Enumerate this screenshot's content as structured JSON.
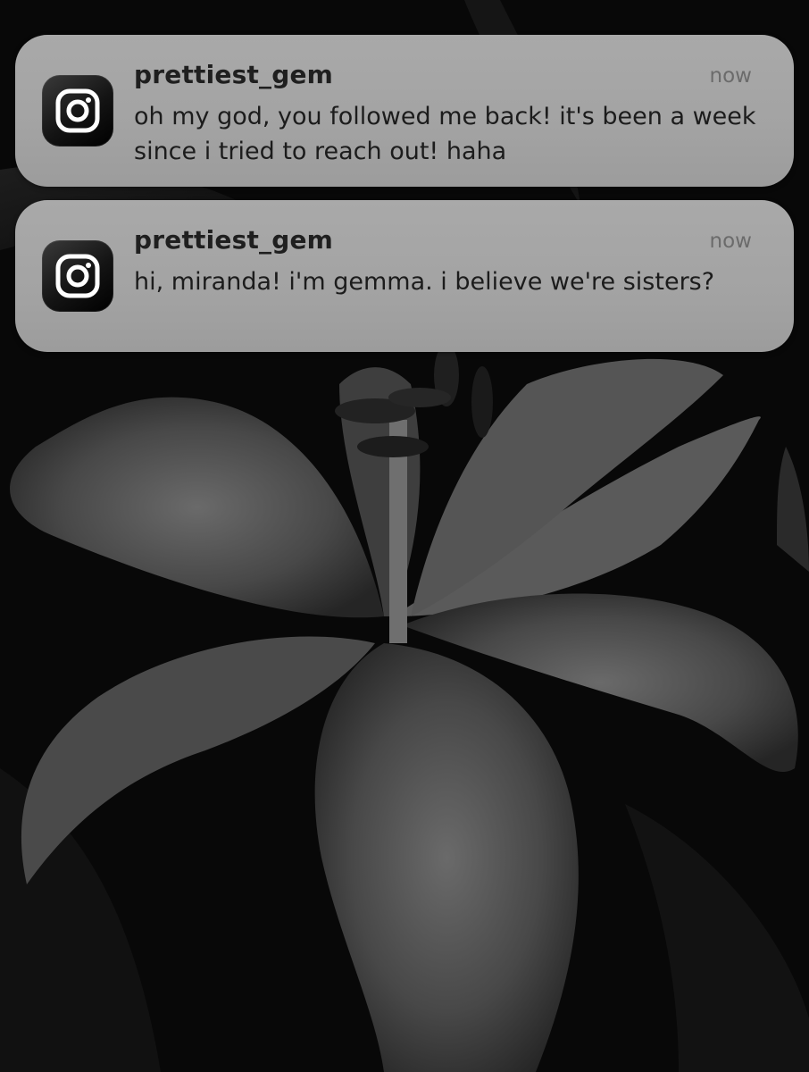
{
  "notifications": [
    {
      "app_icon": "instagram-icon",
      "sender": "prettiest_gem",
      "time": "now",
      "message": "oh my god, you followed me back! it's been a week since i tried to reach out! haha"
    },
    {
      "app_icon": "instagram-icon",
      "sender": "prettiest_gem",
      "time": "now",
      "message": "hi, miranda! i'm gemma. i believe we're sisters?"
    }
  ],
  "wallpaper": {
    "subject": "lily-flower-image"
  }
}
